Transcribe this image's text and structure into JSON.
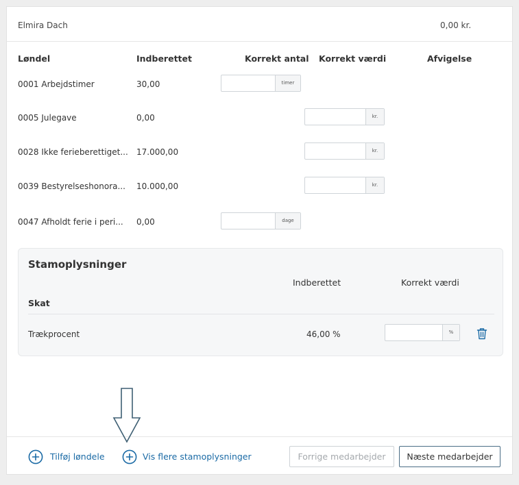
{
  "employee": {
    "name": "Elmira Dach",
    "total": "0,00 kr."
  },
  "table": {
    "headers": {
      "loendel": "Løndel",
      "indberettet": "Indberettet",
      "korrekt_antal": "Korrekt antal",
      "korrekt_vaerdi": "Korrekt værdi",
      "afvigelse": "Afvigelse"
    },
    "rows": [
      {
        "name": "0001 Arbejdstimer",
        "value": "30,00",
        "unit": "timer"
      },
      {
        "name": "0005 Julegave",
        "value": "0,00",
        "unit": "kr."
      },
      {
        "name": "0028 Ikke ferieberettiget...",
        "value": "17.000,00",
        "unit": "kr."
      },
      {
        "name": "0039 Bestyrelseshonora...",
        "value": "10.000,00",
        "unit": "kr."
      },
      {
        "name": "0047 Afholdt ferie i peri...",
        "value": "0,00",
        "unit": "dage"
      }
    ]
  },
  "stamoplysninger": {
    "title": "Stamoplysninger",
    "col_indberettet": "Indberettet",
    "col_korrekt_vaerdi": "Korrekt værdi",
    "group": "Skat",
    "row": {
      "name": "Trækprocent",
      "value": "46,00 %",
      "unit": "%"
    }
  },
  "footer": {
    "add_link": "Tilføj løndele",
    "more_link": "Vis flere stamoplysninger",
    "prev_button": "Forrige medarbejder",
    "next_button": "Næste medarbejder"
  },
  "colors": {
    "accent": "#1a6aa5",
    "arrow": "#3e5f73"
  },
  "icons": {
    "plus": "plus-circle-icon",
    "trash": "trash-icon",
    "arrow": "down-arrow-icon"
  }
}
